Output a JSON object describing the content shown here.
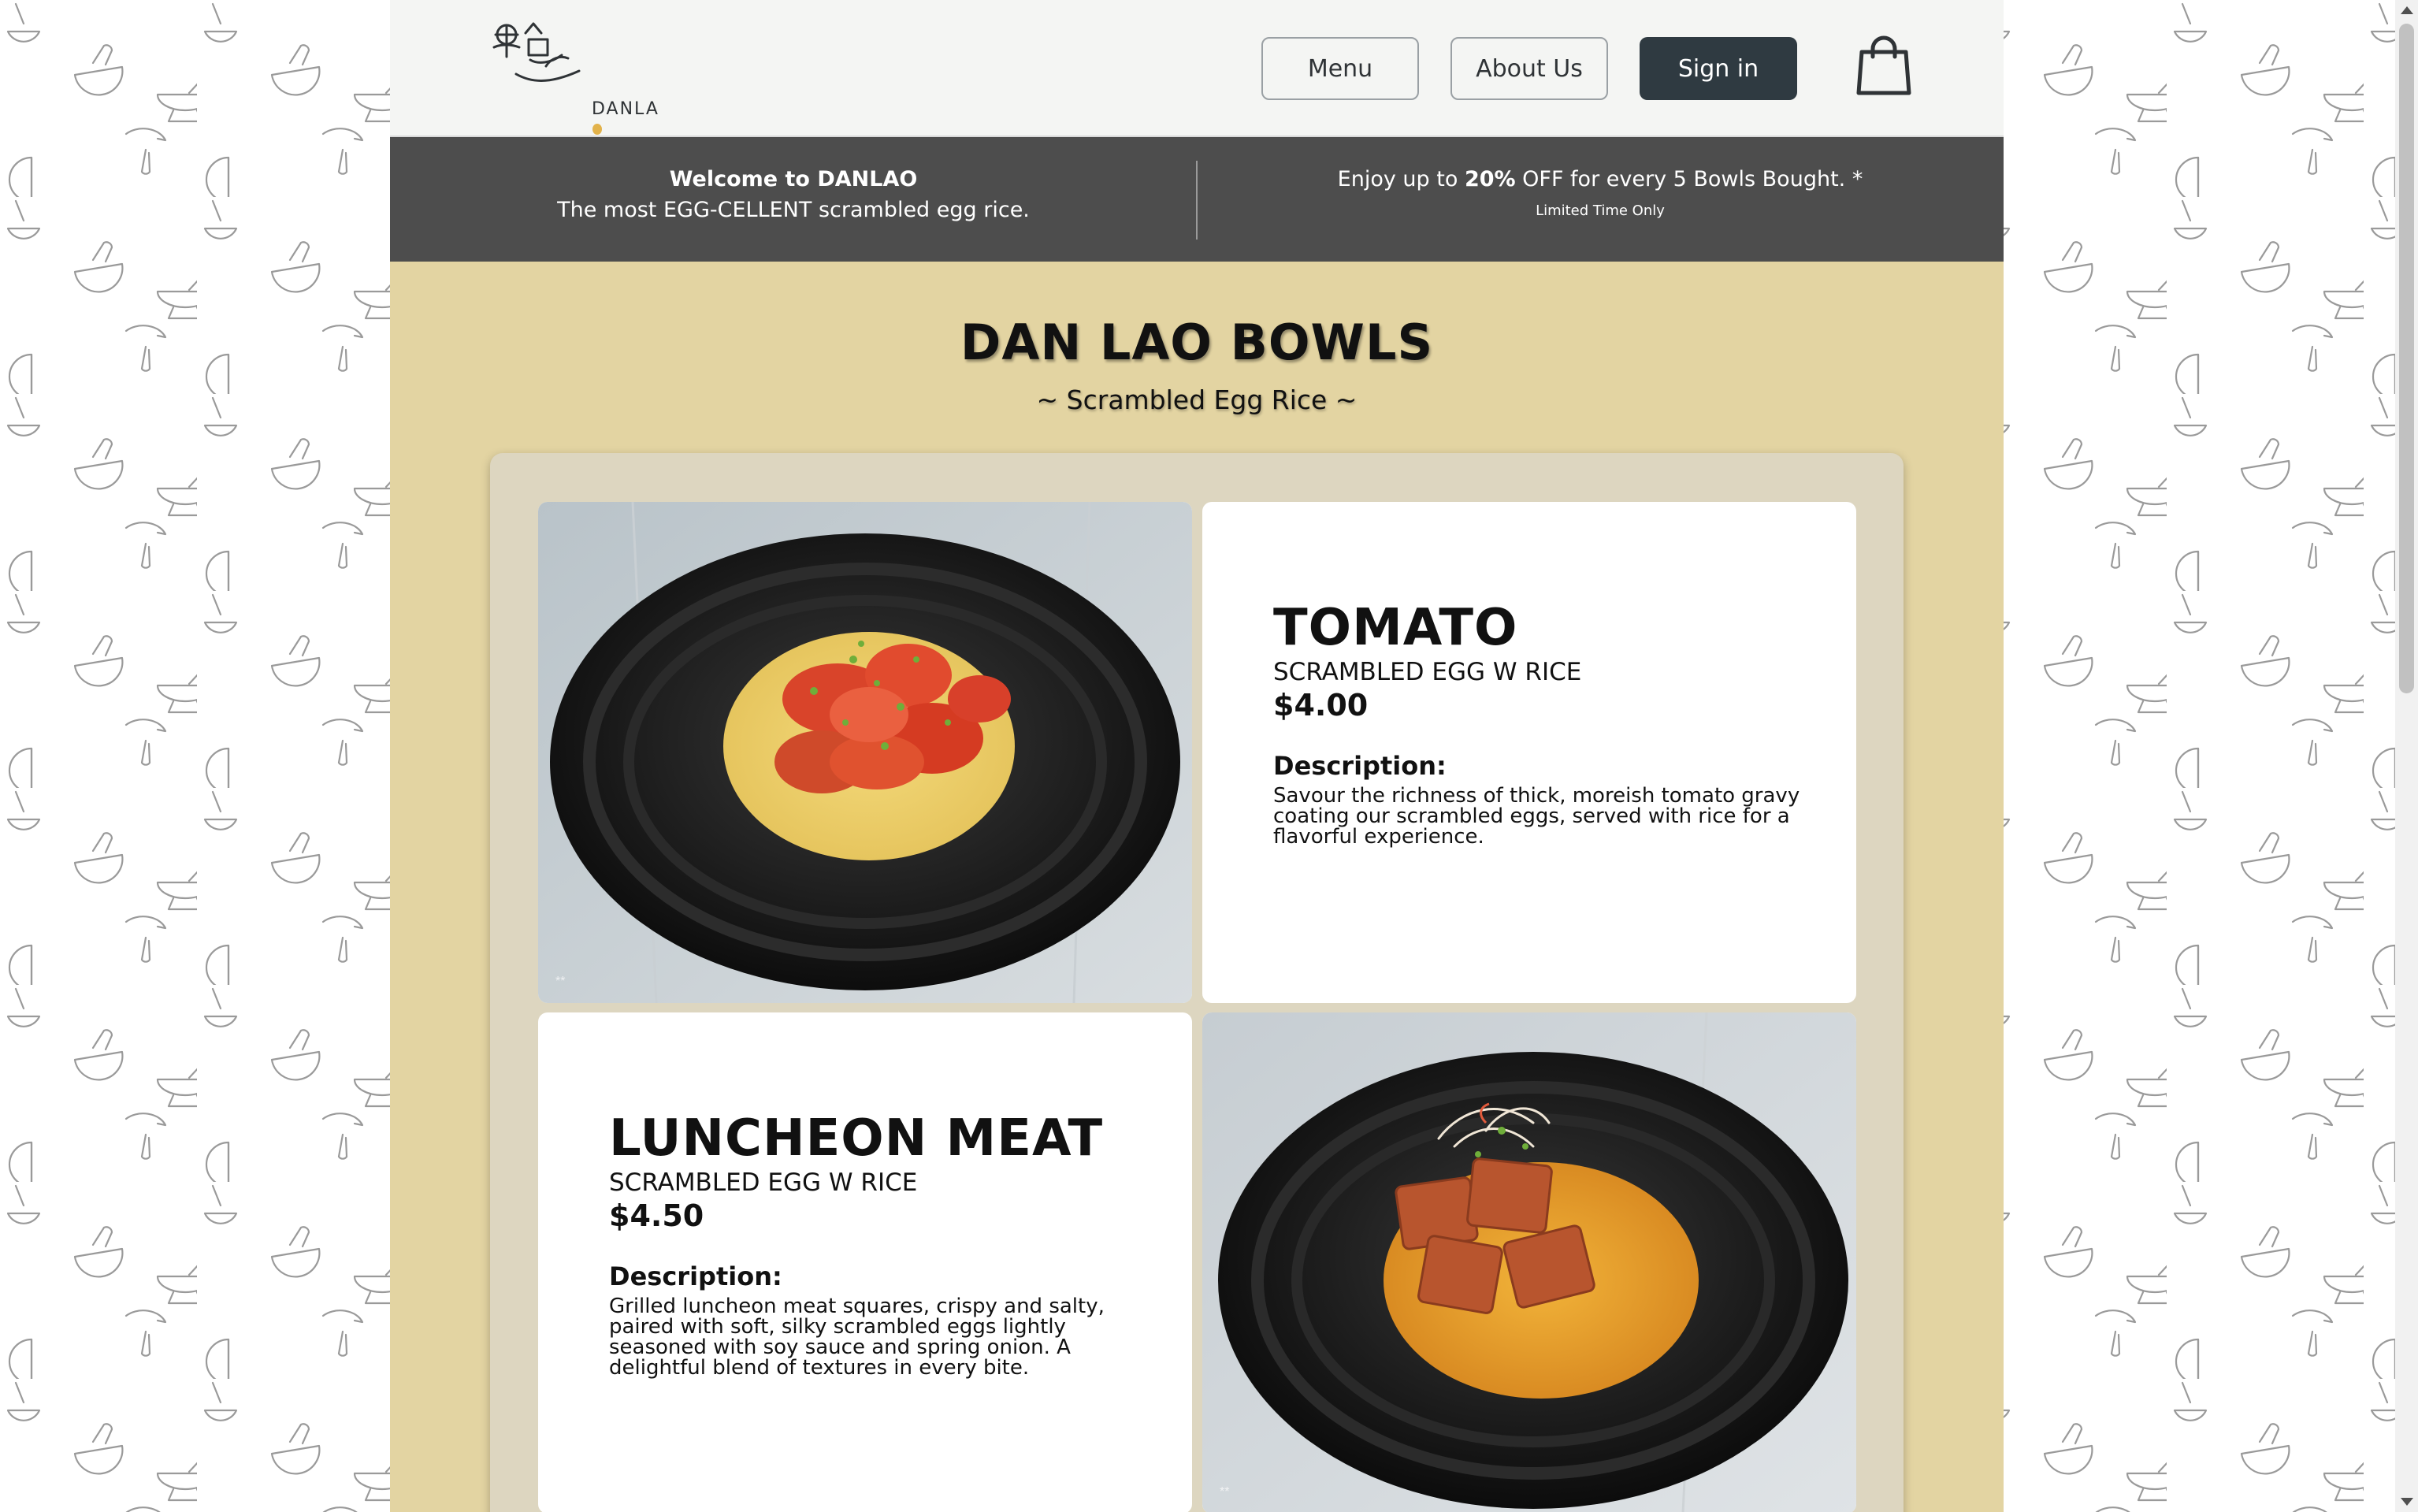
{
  "brand": {
    "name": "DANLA",
    "logo_icon": "danlao-egg-logo-icon"
  },
  "nav": {
    "menu_label": "Menu",
    "about_label": "About Us",
    "signin_label": "Sign in",
    "cart_icon": "shopping-bag-icon"
  },
  "promo": {
    "welcome": "Welcome to DANLAO",
    "tagline": "The most EGG-CELLENT scrambled egg rice.",
    "offer_prefix": "Enjoy up to ",
    "offer_bold": "20%",
    "offer_suffix": " OFF for every 5 Bowls Bought. *",
    "offer_note": "Limited Time Only"
  },
  "section": {
    "title": "DAN LAO BOWLS",
    "subtitle": "~ Scrambled Egg Rice ~"
  },
  "items": [
    {
      "name": "TOMATO",
      "subtitle": "SCRAMBLED EGG W RICE",
      "price": "$4.00",
      "desc_heading": "Description:",
      "description": "Savour the richness of thick, moreish tomato gravy coating our scrambled eggs, served with rice for a flavorful experience.",
      "image": "tomato-egg-rice-bowl-photo"
    },
    {
      "name": "LUNCHEON MEAT",
      "subtitle": "SCRAMBLED EGG W RICE",
      "price": "$4.50",
      "desc_heading": "Description:",
      "description": "Grilled luncheon meat squares, crispy and salty, paired with soft, silky scrambled eggs lightly seasoned with soy sauce and spring onion. A delightful blend of textures in every bite.",
      "image": "luncheon-meat-egg-rice-bowl-photo"
    }
  ],
  "colors": {
    "page_bg": "#e3d4a2",
    "header_bg": "#f4f5f3",
    "promo_bg": "#4d4d4d",
    "signin_bg": "#2f3a41",
    "panel_bg": "#ddd6c0"
  }
}
